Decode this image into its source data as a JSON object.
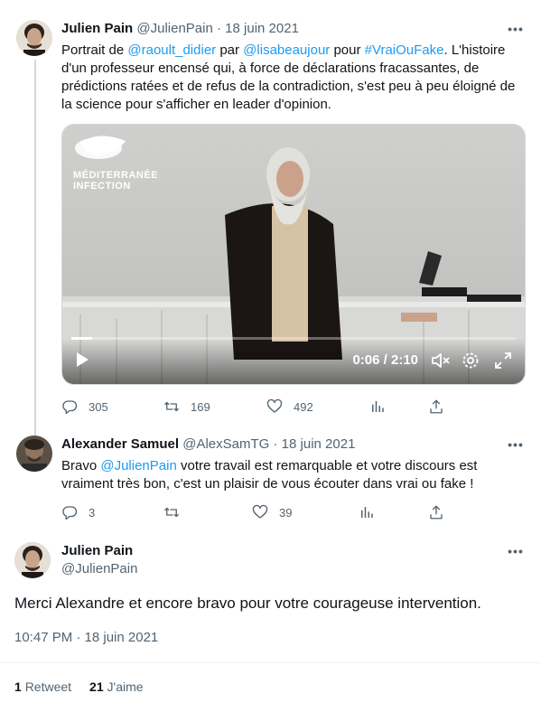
{
  "tweets": [
    {
      "name": "Julien Pain",
      "handle": "@JulienPain",
      "date": "18 juin 2021",
      "text_parts": [
        "Portrait de ",
        "@raoult_didier",
        " par ",
        "@lisabeaujour",
        " pour ",
        "#VraiOuFake",
        ". L'histoire d'un professeur encensé qui, à force de déclarations fracassantes, de prédictions ratées et de refus de la contradiction, s'est peu à peu éloigné de la science pour s'afficher en leader d'opinion."
      ],
      "media": {
        "logo_line1": "MÉDITERRANÉE",
        "logo_line2": "INFECTION",
        "time": "0:06 / 2:10",
        "progress": 0.046
      },
      "replies": "305",
      "retweets": "169",
      "likes": "492"
    },
    {
      "name": "Alexander Samuel",
      "handle": "@AlexSamTG",
      "date": "18 juin 2021",
      "text_parts": [
        "Bravo ",
        "@JulienPain",
        " votre travail est remarquable et votre discours est vraiment très bon, c'est un plaisir de vous écouter dans vrai ou fake !"
      ],
      "replies": "3",
      "retweets": "",
      "likes": "39"
    }
  ],
  "focus": {
    "name": "Julien Pain",
    "handle": "@JulienPain",
    "text": "Merci Alexandre et encore bravo pour votre courageuse intervention.",
    "timestamp": "10:47 PM · 18 juin 2021",
    "retweet_count": "1",
    "retweet_label": "Retweet",
    "like_count": "21",
    "like_label": "J'aime"
  },
  "separator": "·",
  "more_glyph": "•••",
  "colors": {
    "link": "#1d9bf0",
    "muted": "#536471",
    "text": "#0f1419",
    "border": "#cfd9de"
  }
}
